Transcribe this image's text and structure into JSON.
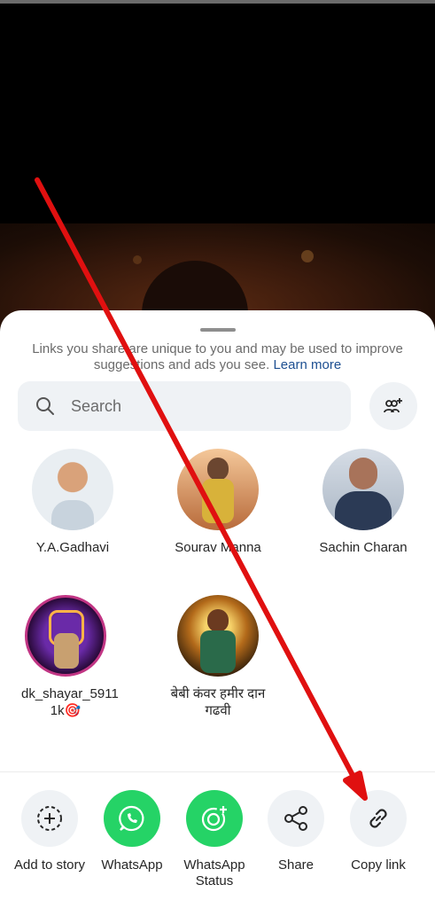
{
  "notice": {
    "text": "Links you share are unique to you and may be used to improve suggestions and ads you see.",
    "link": "Learn more"
  },
  "search": {
    "placeholder": "Search"
  },
  "contacts": [
    {
      "name": "Y.A.Gadhavi"
    },
    {
      "name": "Sourav Manna"
    },
    {
      "name": "Sachin Charan"
    },
    {
      "name": "dk_shayar_5911 1k🎯"
    },
    {
      "name": "बेबी कंवर हमीर दान गढवी"
    }
  ],
  "actions": [
    {
      "label": "Add to story",
      "icon": "add-story-icon"
    },
    {
      "label": "WhatsApp",
      "icon": "whatsapp-icon"
    },
    {
      "label": "WhatsApp Status",
      "icon": "whatsapp-status-icon"
    },
    {
      "label": "Share",
      "icon": "share-icon"
    },
    {
      "label": "Copy link",
      "icon": "link-icon"
    }
  ],
  "colors": {
    "whatsapp": "#25d366",
    "link": "#1d4f91",
    "arrow": "#e01010"
  }
}
